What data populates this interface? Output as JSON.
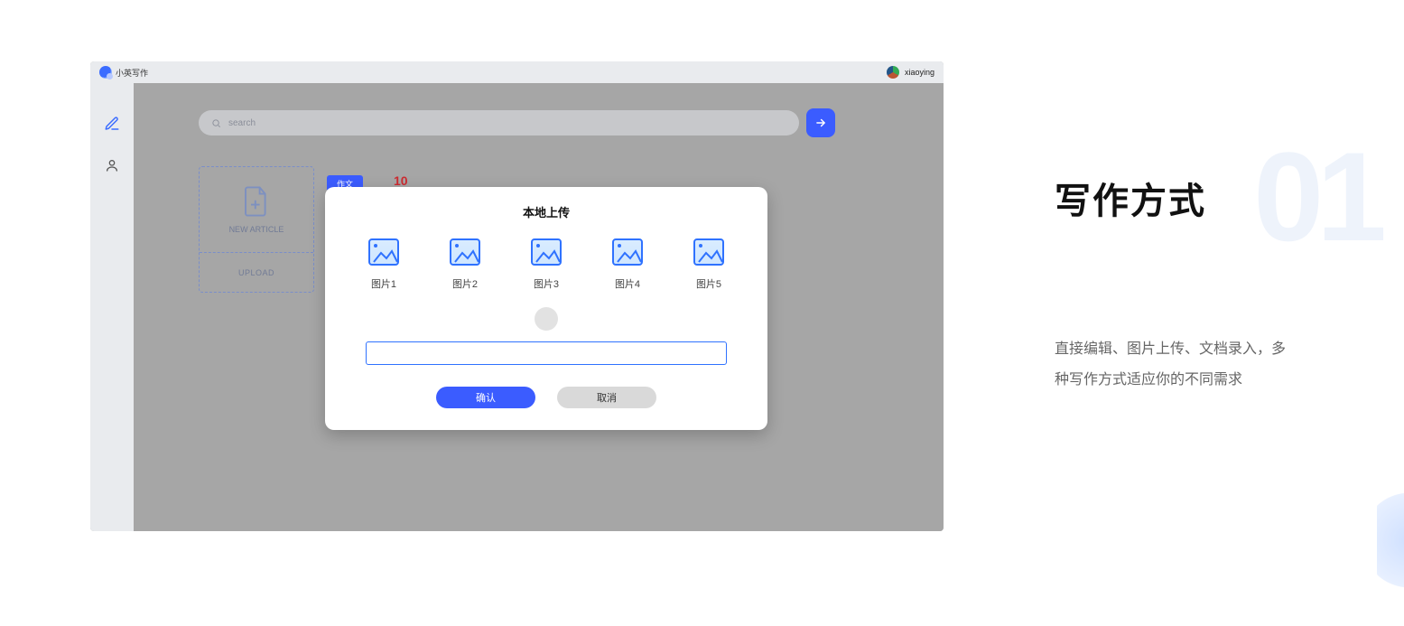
{
  "app": {
    "brand_text": "小英写作",
    "user_name": "xiaoying"
  },
  "search": {
    "placeholder": "search"
  },
  "dashed_card": {
    "new_label": "NEW ARTICLE",
    "upload_label": "UPLOAD"
  },
  "behind_modal": {
    "tag_text": "作文",
    "red_number": "10"
  },
  "modal": {
    "title": "本地上传",
    "thumbs": [
      {
        "label": "图片1"
      },
      {
        "label": "图片2"
      },
      {
        "label": "图片3"
      },
      {
        "label": "图片4"
      },
      {
        "label": "图片5"
      }
    ],
    "input_value": "",
    "confirm_label": "确认",
    "cancel_label": "取消"
  },
  "marketing": {
    "big_number": "01",
    "headline": "写作方式",
    "description": "直接编辑、图片上传、文档录入，多种写作方式适应你的不同需求"
  }
}
